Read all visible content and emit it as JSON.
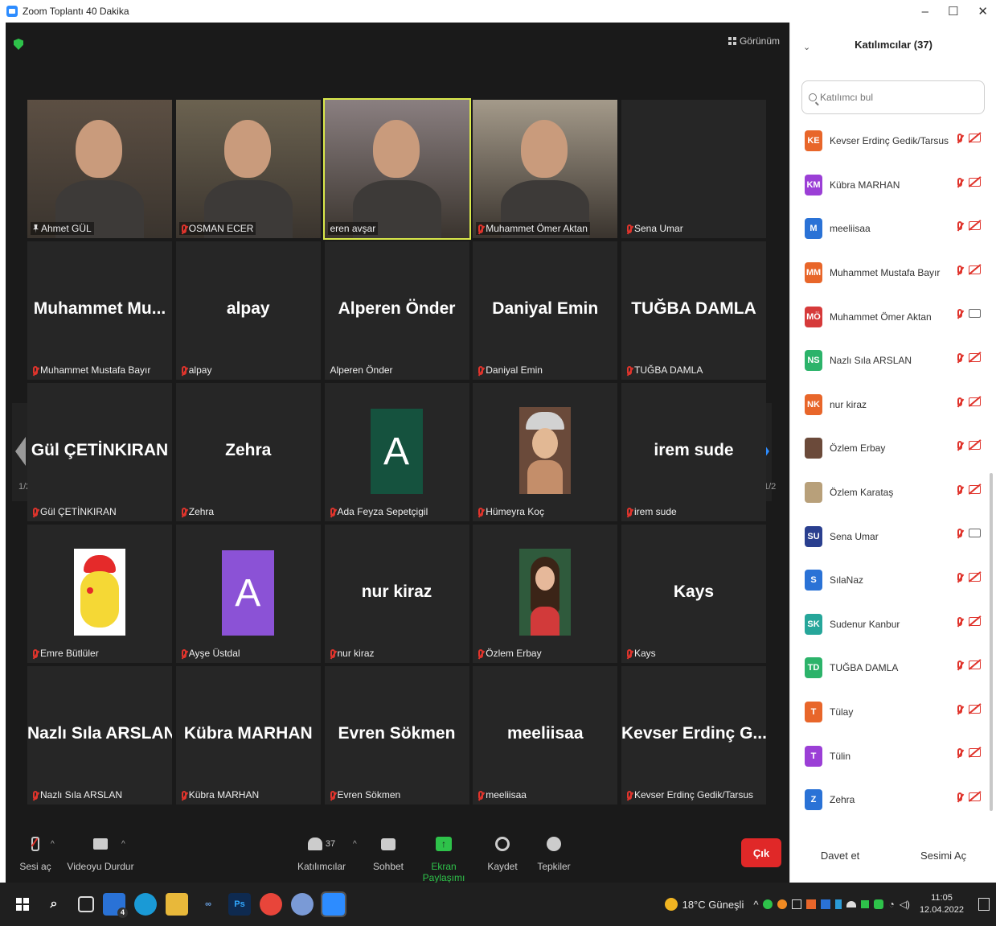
{
  "window": {
    "title": "Zoom Toplantı 40 Dakika",
    "controls": [
      "–",
      "☐",
      "✕"
    ]
  },
  "meeting": {
    "view_label": "Görünüm",
    "page_indicator_left": "1/2",
    "page_indicator_right": "1/2",
    "tiles": [
      {
        "type": "video",
        "label": "Ahmet GÜL",
        "icon": "pin",
        "bg": "#5c4f43"
      },
      {
        "type": "video",
        "label": "OSMAN ECER",
        "icon": "mic-off",
        "bg": "#6b6250"
      },
      {
        "type": "video",
        "label": "eren avşar",
        "icon": "none",
        "bg": "#8a7f80",
        "active": true
      },
      {
        "type": "video",
        "label": "Muhammet Ömer Aktan",
        "icon": "mic-off",
        "bg": "#a49a8a"
      },
      {
        "type": "name",
        "name": "",
        "label": "Sena Umar",
        "icon": "mic-off"
      },
      {
        "type": "name",
        "name": "Muhammet  Mu...",
        "label": "Muhammet Mustafa Bayır",
        "icon": "mic-off"
      },
      {
        "type": "name",
        "name": "alpay",
        "label": "alpay",
        "icon": "mic-off"
      },
      {
        "type": "name",
        "name": "Alperen Önder",
        "label": "Alperen Önder",
        "icon": "none"
      },
      {
        "type": "name",
        "name": "Daniyal Emin",
        "label": "Daniyal Emin",
        "icon": "mic-off"
      },
      {
        "type": "name",
        "name": "TUĞBA DAMLA",
        "label": "TUĞBA DAMLA",
        "icon": "mic-off"
      },
      {
        "type": "name",
        "name": "Gül ÇETİNKIRAN",
        "label": "Gül ÇETİNKIRAN",
        "icon": "mic-off"
      },
      {
        "type": "name",
        "name": "Zehra",
        "label": "Zehra",
        "icon": "mic-off"
      },
      {
        "type": "letter",
        "letter": "A",
        "color": "#15523e",
        "label": "Ada Feyza Sepetçigil",
        "icon": "mic-off"
      },
      {
        "type": "picture",
        "pic": "girl-cartoon",
        "label": "Hümeyra Koç",
        "icon": "mic-off"
      },
      {
        "type": "name",
        "name": "irem sude",
        "label": "irem sude",
        "icon": "mic-off"
      },
      {
        "type": "picture",
        "pic": "pikachu",
        "label": "Emre Bütlüler",
        "icon": "mic-off"
      },
      {
        "type": "letter",
        "letter": "A",
        "color": "#8b52d6",
        "label": "Ayşe Üstdal",
        "icon": "mic-off"
      },
      {
        "type": "name",
        "name": "nur kiraz",
        "label": "nur kiraz",
        "icon": "mic-off"
      },
      {
        "type": "picture",
        "pic": "girl-avatar",
        "label": "Özlem Erbay",
        "icon": "mic-off"
      },
      {
        "type": "name",
        "name": "Kays",
        "label": "Kays",
        "icon": "mic-off"
      },
      {
        "type": "name",
        "name": "Nazlı Sıla ARSLAN",
        "label": "Nazlı Sıla ARSLAN",
        "icon": "mic-off"
      },
      {
        "type": "name",
        "name": "Kübra MARHAN",
        "label": "Kübra MARHAN",
        "icon": "mic-off"
      },
      {
        "type": "name",
        "name": "Evren Sökmen",
        "label": "Evren Sökmen",
        "icon": "mic-off"
      },
      {
        "type": "name",
        "name": "meeliisaa",
        "label": "meeliisaa",
        "icon": "mic-off"
      },
      {
        "type": "name",
        "name": "Kevser  Erdinç G...",
        "label": "Kevser Erdinç Gedik/Tarsus",
        "icon": "mic-off"
      }
    ]
  },
  "toolbar": {
    "unmute_label": "Sesi aç",
    "stop_video_label": "Videoyu Durdur",
    "participants_label": "Katılımcılar",
    "participants_count": "37",
    "chat_label": "Sohbet",
    "share_label": "Ekran Paylaşımı",
    "record_label": "Kaydet",
    "reactions_label": "Tepkiler",
    "end_label": "Çık",
    "share_color": "#2ec24a"
  },
  "panel": {
    "title": "Katılımcılar (37)",
    "search_placeholder": "Katılımcı bul",
    "participants": [
      {
        "initials": "KE",
        "name": "Kevser Erdinç Gedik/Tarsus",
        "color": "#e8662a",
        "cam": "off"
      },
      {
        "initials": "KM",
        "name": "Kübra MARHAN",
        "color": "#9b3fd6",
        "cam": "off"
      },
      {
        "initials": "M",
        "name": "meeliisaa",
        "color": "#2a72d6",
        "cam": "off"
      },
      {
        "initials": "MM",
        "name": "Muhammet Mustafa Bayır",
        "color": "#e8662a",
        "cam": "off"
      },
      {
        "initials": "MÖ",
        "name": "Muhammet Ömer Aktan",
        "color": "#d63a3a",
        "cam": "on"
      },
      {
        "initials": "NS",
        "name": "Nazlı Sıla ARSLAN",
        "color": "#2cb36a",
        "cam": "off"
      },
      {
        "initials": "NK",
        "name": "nur kiraz",
        "color": "#e8662a",
        "cam": "off"
      },
      {
        "initials": "",
        "name": "Özlem Erbay",
        "color": "#6b4a3a",
        "cam": "off",
        "photo": true
      },
      {
        "initials": "",
        "name": "Özlem Karataş",
        "color": "#b8a07a",
        "cam": "off",
        "photo": true
      },
      {
        "initials": "SU",
        "name": "Sena Umar",
        "color": "#2a3f8f",
        "cam": "on"
      },
      {
        "initials": "S",
        "name": "SılaNaz",
        "color": "#2a72d6",
        "cam": "off"
      },
      {
        "initials": "SK",
        "name": "Sudenur Kanbur",
        "color": "#26a69a",
        "cam": "off"
      },
      {
        "initials": "TD",
        "name": "TUĞBA DAMLA",
        "color": "#2cb36a",
        "cam": "off"
      },
      {
        "initials": "T",
        "name": "Tülay",
        "color": "#e8662a",
        "cam": "off"
      },
      {
        "initials": "T",
        "name": "Tülin",
        "color": "#9b3fd6",
        "cam": "off"
      },
      {
        "initials": "Z",
        "name": "Zehra",
        "color": "#2a72d6",
        "cam": "off"
      }
    ],
    "invite_label": "Davet et",
    "unmute_me_label": "Sesimi Aç"
  },
  "taskbar": {
    "weather": "18°C  Güneşli",
    "time": "11:05",
    "date": "12.04.2022",
    "mail_badge": "4"
  }
}
